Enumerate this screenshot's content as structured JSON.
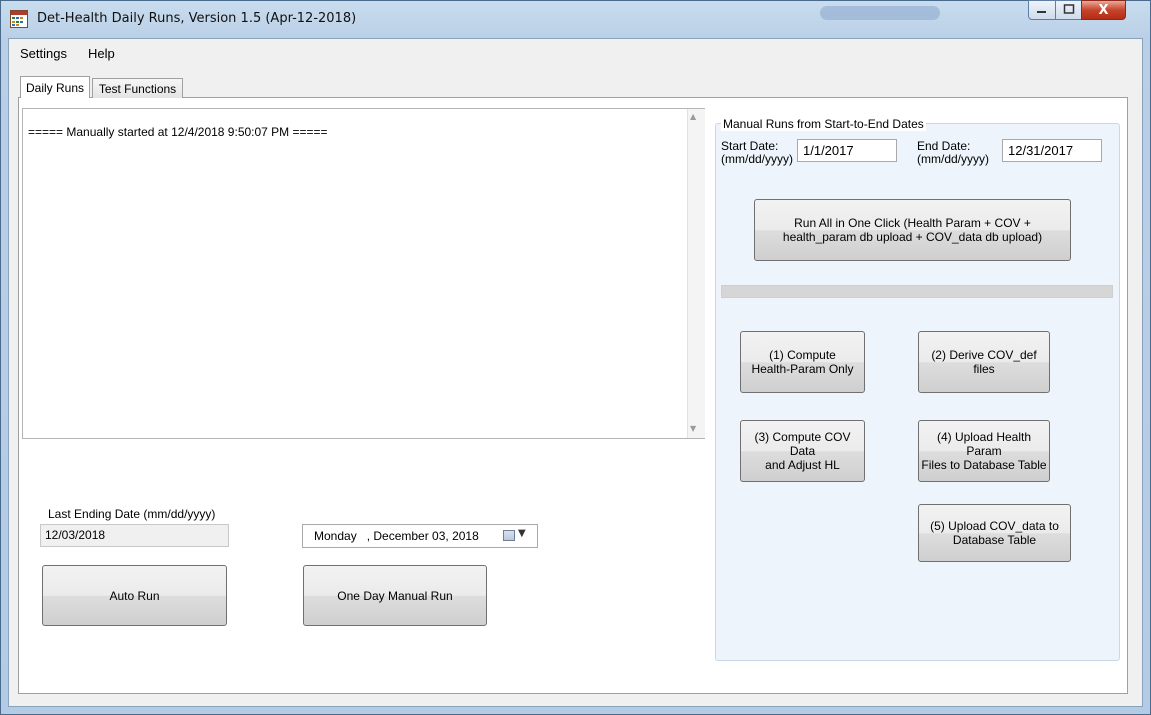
{
  "window": {
    "title": "Det-Health Daily Runs, Version 1.5 (Apr-12-2018)",
    "controls": {
      "minimize": "—",
      "maximize": "□",
      "close": "X"
    }
  },
  "menu": {
    "items": [
      "Settings",
      "Help"
    ]
  },
  "tabs": [
    {
      "label": "Daily Runs",
      "selected": true
    },
    {
      "label": "Test Functions",
      "selected": false
    }
  ],
  "log": {
    "text": "===== Manually started at 12/4/2018 9:50:07 PM ====="
  },
  "last_ending": {
    "label": "Last Ending Date (mm/dd/yyyy)",
    "value": "12/03/2018"
  },
  "date_picker": {
    "value": "Monday   , December 03, 2018"
  },
  "buttons": {
    "auto_run": "Auto Run",
    "one_day_manual_run": "One Day Manual Run"
  },
  "manual_runs": {
    "group_title": "Manual Runs from Start-to-End  Dates",
    "start_label_1": "Start Date:",
    "start_label_2": "(mm/dd/yyyy)",
    "start_value": "1/1/2017",
    "end_label_1": "End Date:",
    "end_label_2": "(mm/dd/yyyy)",
    "end_value": "12/31/2017",
    "run_all_line1": "Run All in One Click (Health Param + COV +",
    "run_all_line2": "health_param db upload + COV_data db upload)",
    "progress": 0,
    "step1_line1": "(1) Compute",
    "step1_line2": "Health-Param Only",
    "step2": "(2) Derive COV_def files",
    "step3_line1": "(3) Compute COV Data",
    "step3_line2": "and Adjust HL",
    "step4_line1": "(4) Upload Health Param",
    "step4_line2": "Files to Database Table",
    "step5_line1": "(5) Upload COV_data to",
    "step5_line2": "Database Table"
  },
  "icons": {
    "app": "calendar-grid-icon",
    "calendar": "calendar-icon",
    "dropdown": "chevron-down-icon"
  },
  "colors": {
    "title_bar": "#b9cfe6",
    "close_button": "#c7432b",
    "group_background": "#edf4fb"
  }
}
